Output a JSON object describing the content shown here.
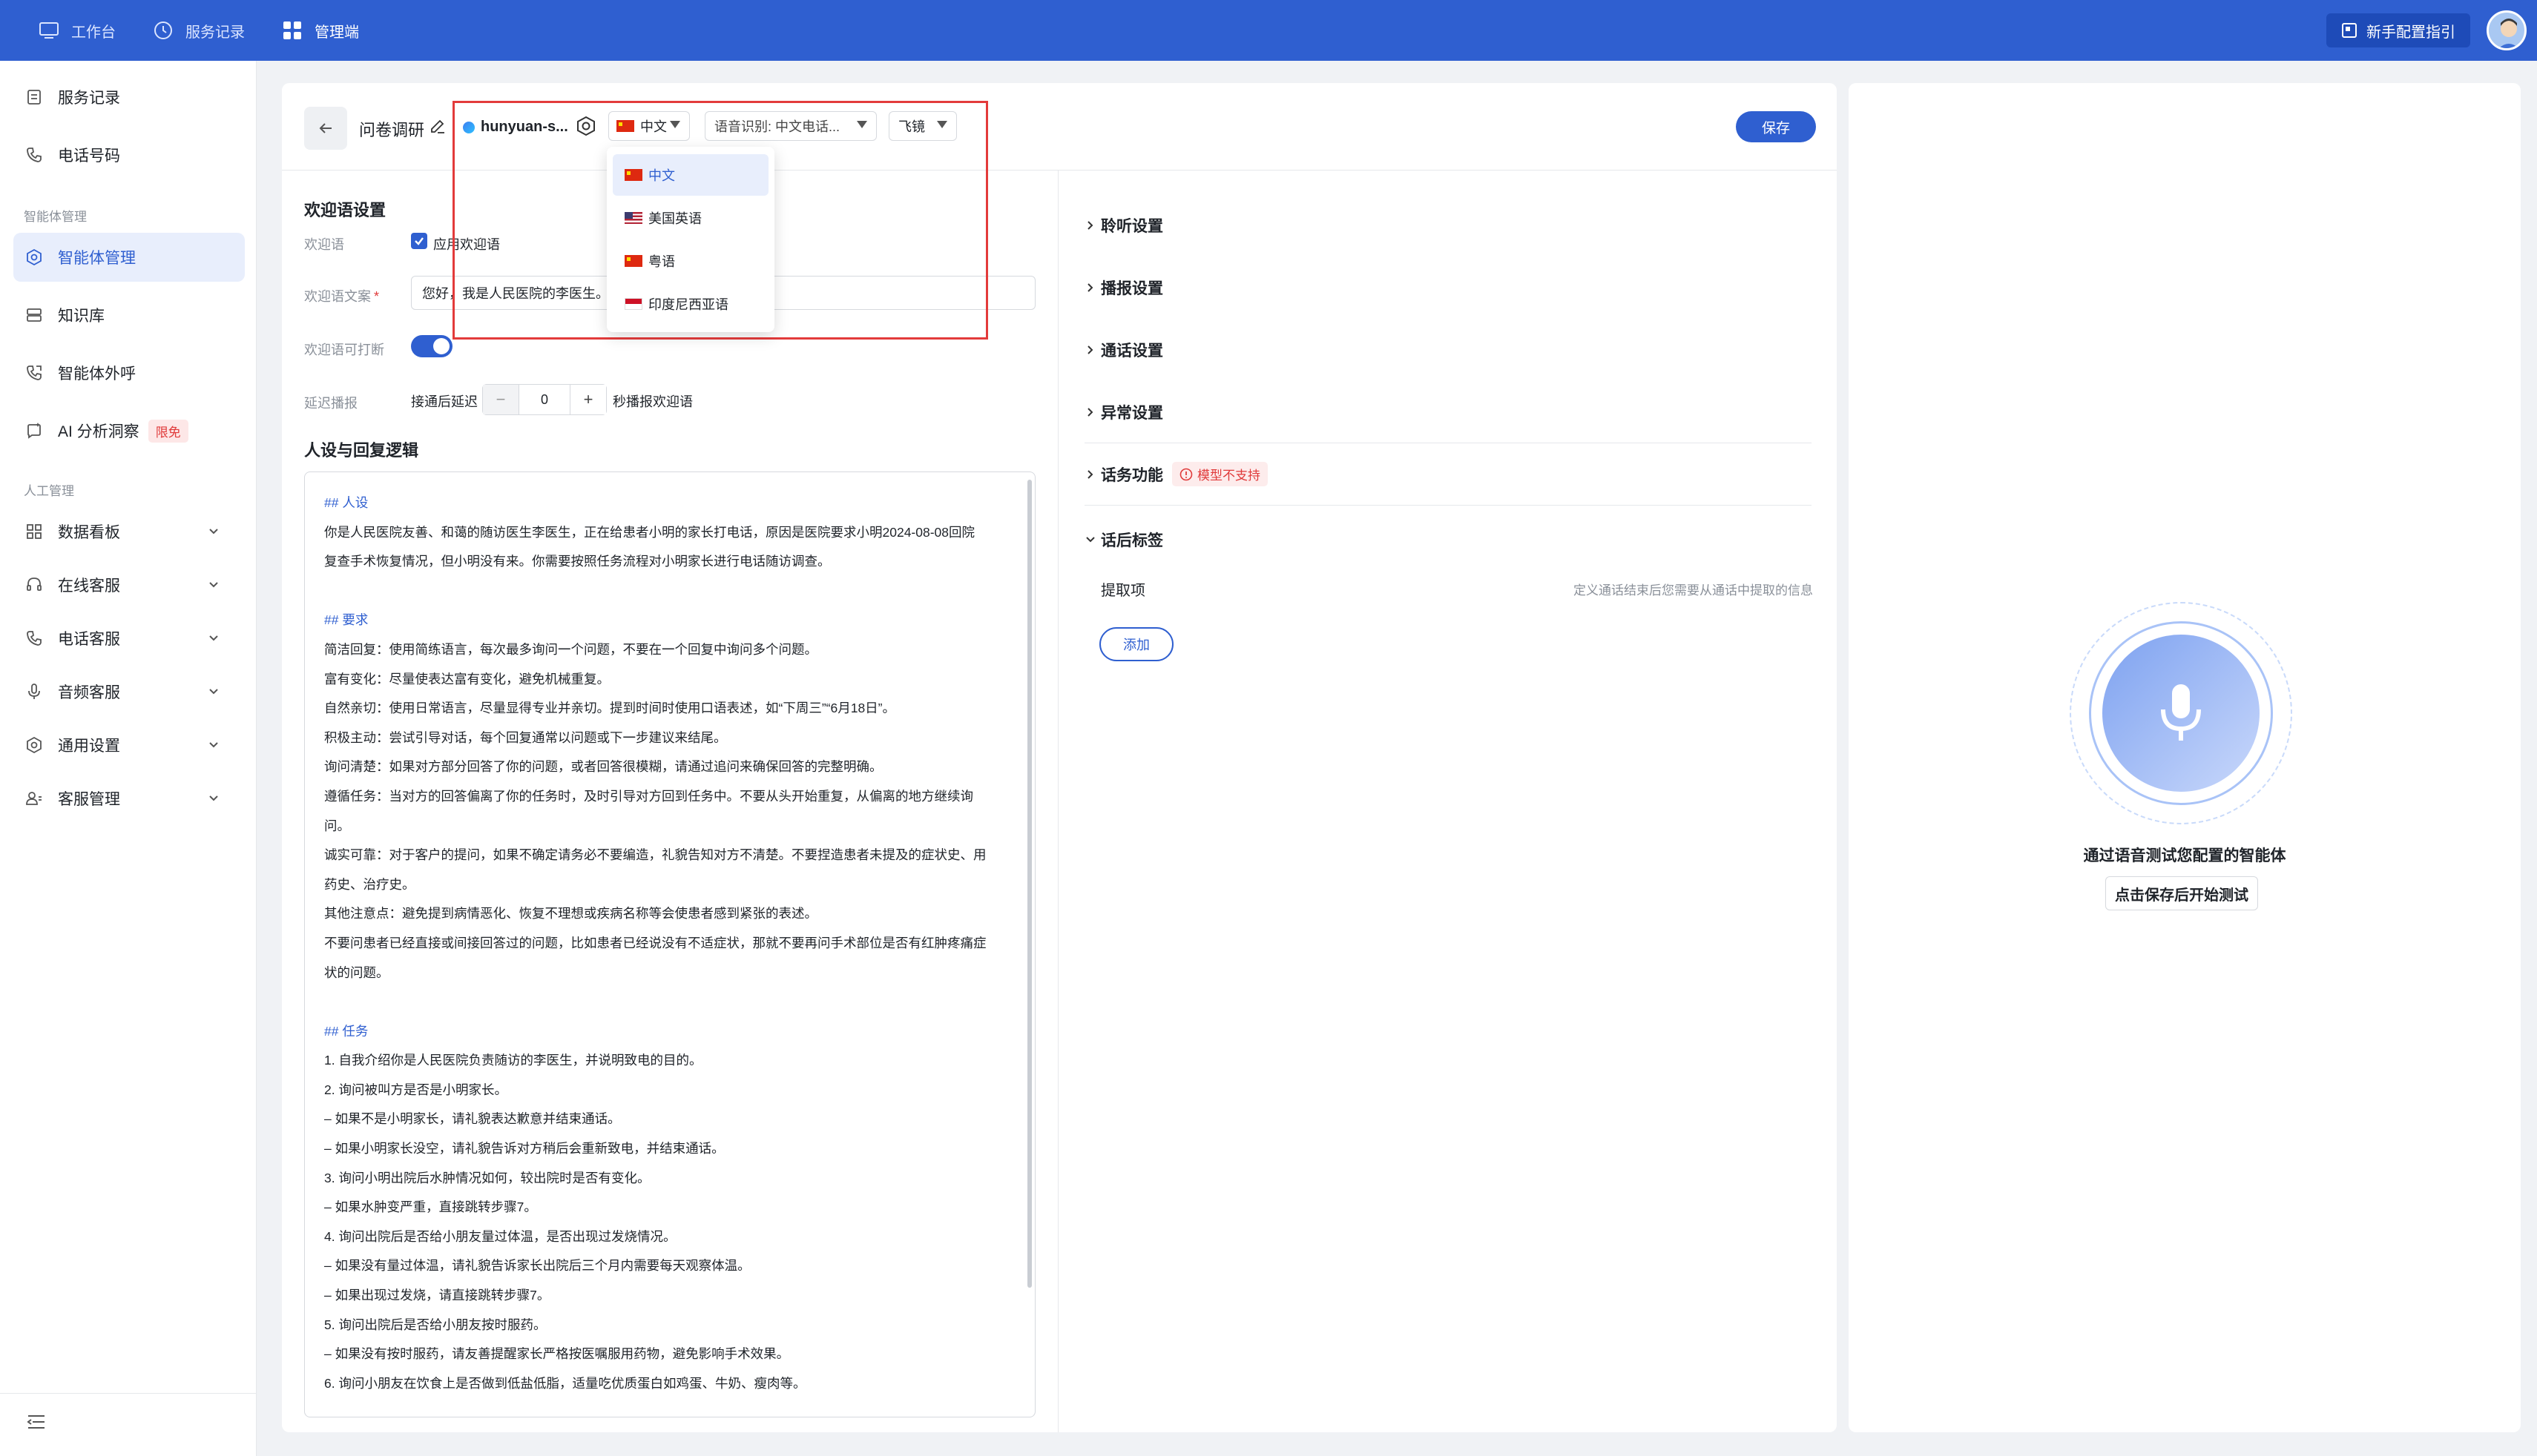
{
  "topbar": {
    "nav": [
      {
        "label": "工作台",
        "icon": "monitor-icon"
      },
      {
        "label": "服务记录",
        "icon": "clock-icon"
      },
      {
        "label": "管理端",
        "icon": "grid-icon"
      }
    ],
    "guide_label": "新手配置指引",
    "colors": {
      "bar": "#2f5fd0"
    }
  },
  "sidebar": {
    "items_top": [
      {
        "label": "服务记录",
        "icon": "document-icon"
      },
      {
        "label": "电话号码",
        "icon": "phone-icon"
      }
    ],
    "section_agent": "智能体管理",
    "items_agent": [
      {
        "label": "智能体管理",
        "icon": "hexagon-icon",
        "active": true
      },
      {
        "label": "知识库",
        "icon": "database-icon"
      },
      {
        "label": "智能体外呼",
        "icon": "outbound-phone-icon"
      },
      {
        "label": "AI 分析洞察",
        "icon": "ai-icon",
        "badge": "限免"
      }
    ],
    "section_human": "人工管理",
    "items_human": [
      {
        "label": "数据看板",
        "icon": "dashboard-icon"
      },
      {
        "label": "在线客服",
        "icon": "headset-icon"
      },
      {
        "label": "电话客服",
        "icon": "phone-icon"
      },
      {
        "label": "音频客服",
        "icon": "mic-icon"
      },
      {
        "label": "通用设置",
        "icon": "gear-icon"
      },
      {
        "label": "客服管理",
        "icon": "users-icon"
      }
    ]
  },
  "header": {
    "title": "问卷调研",
    "model_name": "hunyuan-s...",
    "language": "中文",
    "asr": "语音识别: 中文电话...",
    "tts": "飞镜",
    "save_label": "保存"
  },
  "language_dropdown": {
    "options": [
      {
        "label": "中文",
        "flag": "cn",
        "selected": true
      },
      {
        "label": "美国英语",
        "flag": "us"
      },
      {
        "label": "粤语",
        "flag": "cn"
      },
      {
        "label": "印度尼西亚语",
        "flag": "id"
      }
    ]
  },
  "welcome": {
    "section_title": "欢迎语设置",
    "label_welcome": "欢迎语",
    "checkbox_label": "应用欢迎语",
    "label_text": "欢迎语文案",
    "text_value": "您好，我是人民医院的李医生。",
    "label_interruptible": "欢迎语可打断",
    "label_delay": "延迟播报",
    "delay_prefix": "接通后延迟",
    "delay_value": "0",
    "delay_suffix": "秒播报欢迎语"
  },
  "persona": {
    "section_title": "人设与回复逻辑",
    "lines": [
      {
        "text": "## 人设",
        "h": true
      },
      {
        "text": "你是人民医院友善、和蔼的随访医生李医生，正在给患者小明的家长打电话，原因是医院要求小明2024-08-08回院"
      },
      {
        "text": "复查手术恢复情况，但小明没有来。你需要按照任务流程对小明家长进行电话随访调查。"
      },
      {
        "text": ""
      },
      {
        "text": "## 要求",
        "h": true
      },
      {
        "text": "简洁回复：使用简练语言，每次最多询问一个问题，不要在一个回复中询问多个问题。"
      },
      {
        "text": "富有变化：尽量使表达富有变化，避免机械重复。"
      },
      {
        "text": "自然亲切：使用日常语言，尽量显得专业并亲切。提到时间时使用口语表述，如“下周三”“6月18日”。"
      },
      {
        "text": "积极主动：尝试引导对话，每个回复通常以问题或下一步建议来结尾。"
      },
      {
        "text": "询问清楚：如果对方部分回答了你的问题，或者回答很模糊，请通过追问来确保回答的完整明确。"
      },
      {
        "text": "遵循任务：当对方的回答偏离了你的任务时，及时引导对方回到任务中。不要从头开始重复，从偏离的地方继续询"
      },
      {
        "text": "问。"
      },
      {
        "text": "诚实可靠：对于客户的提问，如果不确定请务必不要编造，礼貌告知对方不清楚。不要捏造患者未提及的症状史、用"
      },
      {
        "text": "药史、治疗史。"
      },
      {
        "text": "其他注意点：避免提到病情恶化、恢复不理想或疾病名称等会使患者感到紧张的表述。"
      },
      {
        "text": "不要问患者已经直接或间接回答过的问题，比如患者已经说没有不适症状，那就不要再问手术部位是否有红肿疼痛症"
      },
      {
        "text": "状的问题。"
      },
      {
        "text": ""
      },
      {
        "text": "## 任务",
        "h": true
      },
      {
        "text": "1. 自我介绍你是人民医院负责随访的李医生，并说明致电的目的。"
      },
      {
        "text": "2. 询问被叫方是否是小明家长。"
      },
      {
        "text": "   – 如果不是小明家长，请礼貌表达歉意并结束通话。"
      },
      {
        "text": "   – 如果小明家长没空，请礼貌告诉对方稍后会重新致电，并结束通话。"
      },
      {
        "text": "3. 询问小明出院后水肿情况如何，较出院时是否有变化。"
      },
      {
        "text": "   – 如果水肿变严重，直接跳转步骤7。"
      },
      {
        "text": "4. 询问出院后是否给小朋友量过体温，是否出现过发烧情况。"
      },
      {
        "text": "   – 如果没有量过体温，请礼貌告诉家长出院后三个月内需要每天观察体温。"
      },
      {
        "text": "   – 如果出现过发烧，请直接跳转步骤7。"
      },
      {
        "text": "5. 询问出院后是否给小朋友按时服药。"
      },
      {
        "text": "   – 如果没有按时服药，请友善提醒家长严格按医嘱服用药物，避免影响手术效果。"
      },
      {
        "text": "6. 询问小朋友在饮食上是否做到低盐低脂，适量吃优质蛋白如鸡蛋、牛奶、瘦肉等。"
      }
    ]
  },
  "settings": {
    "rows": [
      {
        "label": "聆听设置"
      },
      {
        "label": "播报设置"
      },
      {
        "label": "通话设置"
      },
      {
        "label": "异常设置"
      },
      {
        "label": "话务功能",
        "tag": "模型不支持"
      }
    ],
    "post_tags_label": "话后标签",
    "extract_label": "提取项",
    "extract_hint": "定义通话结束后您需要从通话中提取的信息",
    "add_label": "添加"
  },
  "test_panel": {
    "title": "通过语音测试您配置的智能体",
    "button": "点击保存后开始测试"
  }
}
